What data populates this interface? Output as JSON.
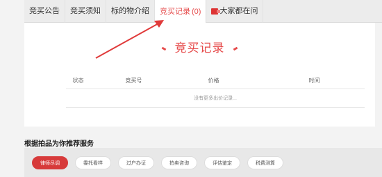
{
  "tabs": [
    {
      "label": "竞买公告"
    },
    {
      "label": "竞买须知"
    },
    {
      "label": "标的物介绍"
    },
    {
      "label": "竞买记录",
      "count": "(0)"
    },
    {
      "label": "大家都在问"
    }
  ],
  "record": {
    "title": "竞买记录",
    "columns": [
      "状态",
      "竞买号",
      "价格",
      "时间"
    ],
    "empty_text": "没有更多出价记录..."
  },
  "recommend": {
    "title": "根据拍品为你推荐服务",
    "chips": [
      "律师尽调",
      "委托看样",
      "过户办证",
      "拍卖咨询",
      "评估鉴定",
      "税费测算"
    ]
  },
  "colors": {
    "accent": "#e64a4a",
    "arrow": "#e03a3a"
  }
}
